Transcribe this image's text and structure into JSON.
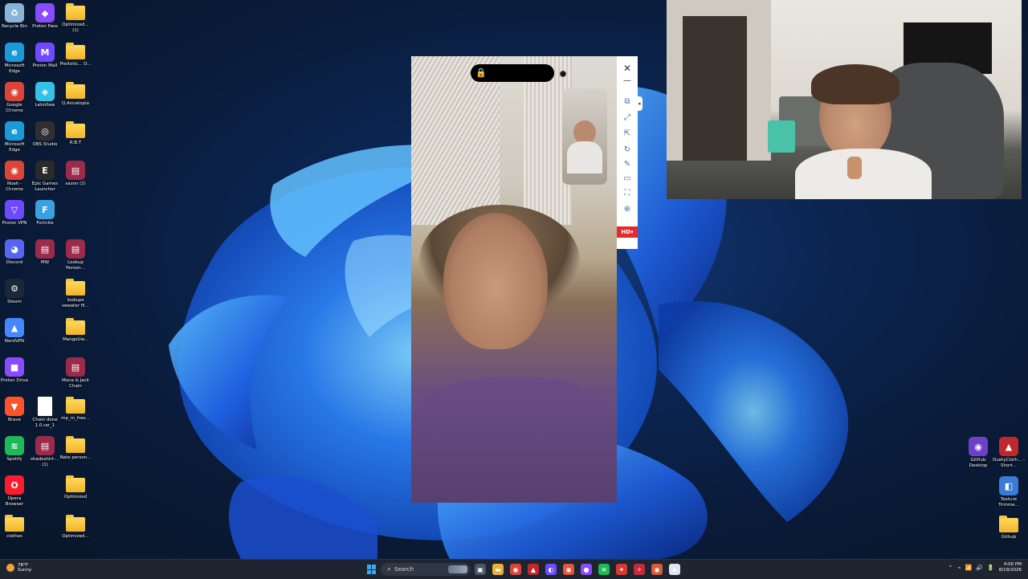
{
  "desktop": {
    "icons_col1": [
      {
        "label": "Recycle Bin",
        "icon": "recycle-bin-icon",
        "color": "#8ab4d6",
        "glyph": "♻"
      },
      {
        "label": "Microsoft Edge",
        "icon": "edge-icon",
        "color": "#1a9ad6",
        "glyph": "e"
      },
      {
        "label": "Google Chrome",
        "icon": "chrome-icon",
        "color": "#db4437",
        "glyph": "◉"
      },
      {
        "label": "Microsoft Edge",
        "icon": "edge-icon",
        "color": "#1a9ad6",
        "glyph": "e"
      },
      {
        "label": "Noah - Chrome",
        "icon": "chrome-icon",
        "color": "#db4437",
        "glyph": "◉"
      },
      {
        "label": "Proton VPN",
        "icon": "proton-vpn-icon",
        "color": "#6d4aff",
        "glyph": "▽"
      },
      {
        "label": "Discord",
        "icon": "discord-icon",
        "color": "#5865f2",
        "glyph": "◕"
      },
      {
        "label": "Steam",
        "icon": "steam-icon",
        "color": "#1b2838",
        "glyph": "⚙"
      },
      {
        "label": "NordVPN",
        "icon": "nordvpn-icon",
        "color": "#4687ff",
        "glyph": "▲"
      },
      {
        "label": "Proton Drive",
        "icon": "proton-drive-icon",
        "color": "#8a4aff",
        "glyph": "■"
      },
      {
        "label": "Brave",
        "icon": "brave-icon",
        "color": "#fb542b",
        "glyph": "▼"
      },
      {
        "label": "Spotify",
        "icon": "spotify-icon",
        "color": "#1db954",
        "glyph": "≋"
      },
      {
        "label": "Opera Browser",
        "icon": "opera-icon",
        "color": "#ff1b2d",
        "glyph": "O"
      },
      {
        "label": "clothes",
        "icon": "folder-icon",
        "color": "#f0b429",
        "glyph": ""
      }
    ],
    "icons_col2": [
      {
        "label": "Proton Pass",
        "icon": "proton-pass-icon",
        "color": "#8a4aff",
        "glyph": "◆"
      },
      {
        "label": "Proton Mail",
        "icon": "proton-mail-icon",
        "color": "#6d4aff",
        "glyph": "M"
      },
      {
        "label": "LetsView",
        "icon": "letsview-icon",
        "color": "#36c0e8",
        "glyph": "◈"
      },
      {
        "label": "OBS Studio",
        "icon": "obs-icon",
        "color": "#302e31",
        "glyph": "◎"
      },
      {
        "label": "Epic Games Launcher",
        "icon": "epic-games-icon",
        "color": "#2a2a2a",
        "glyph": "E"
      },
      {
        "label": "Fortnite",
        "icon": "fortnite-icon",
        "color": "#3aa0e0",
        "glyph": "F"
      },
      {
        "label": "MW",
        "icon": "winrar-icon",
        "color": "#9c2a4a",
        "glyph": "▤"
      },
      {
        "label": "",
        "icon": "",
        "color": "",
        "glyph": ""
      },
      {
        "label": "",
        "icon": "",
        "color": "",
        "glyph": ""
      },
      {
        "label": "",
        "icon": "",
        "color": "",
        "glyph": ""
      },
      {
        "label": "Chain done 1.0.rar_1",
        "icon": "file-icon",
        "color": "#ffffff",
        "glyph": ""
      },
      {
        "label": "shadeshirt-... (1)",
        "icon": "winrar-icon",
        "color": "#9c2a4a",
        "glyph": "▤"
      },
      {
        "label": "",
        "icon": "",
        "color": "",
        "glyph": ""
      },
      {
        "label": "",
        "icon": "",
        "color": "",
        "glyph": ""
      }
    ],
    "icons_col3": [
      {
        "label": "Optimized... (1)",
        "icon": "folder-icon",
        "color": "#f0b429",
        "glyph": ""
      },
      {
        "label": "PreXotic... O...",
        "icon": "folder-icon",
        "color": "#f0b429",
        "glyph": ""
      },
      {
        "label": "Q.Annatopia",
        "icon": "folder-icon",
        "color": "#f0b429",
        "glyph": ""
      },
      {
        "label": "R.B.T",
        "icon": "folder-icon",
        "color": "#f0b429",
        "glyph": ""
      },
      {
        "label": "sazon (2)",
        "icon": "winrar-icon",
        "color": "#9c2a4a",
        "glyph": "▤"
      },
      {
        "label": "",
        "icon": "",
        "color": "",
        "glyph": ""
      },
      {
        "label": "Lookup Person...",
        "icon": "winrar-icon",
        "color": "#9c2a4a",
        "glyph": "▤"
      },
      {
        "label": "lookups sweater fil...",
        "icon": "folder-icon",
        "color": "#f0b429",
        "glyph": ""
      },
      {
        "label": "MangoUw...",
        "icon": "folder-icon",
        "color": "#f0b429",
        "glyph": ""
      },
      {
        "label": "Mona & Jack Chain",
        "icon": "winrar-icon",
        "color": "#9c2a4a",
        "glyph": "▤"
      },
      {
        "label": "mp_m_free...",
        "icon": "folder-icon",
        "color": "#f0b429",
        "glyph": ""
      },
      {
        "label": "Nate person...",
        "icon": "folder-icon",
        "color": "#f0b429",
        "glyph": ""
      },
      {
        "label": "Optimized",
        "icon": "folder-icon",
        "color": "#f0b429",
        "glyph": ""
      },
      {
        "label": "Optimized...",
        "icon": "folder-icon",
        "color": "#f0b429",
        "glyph": ""
      }
    ],
    "icons_right": [
      {
        "label": "GitHub Desktop",
        "icon": "github-desktop-icon",
        "color": "#6e40c9",
        "glyph": "◉"
      },
      {
        "label": "DuetyCloth... - Short...",
        "icon": "shortcut-icon",
        "color": "#c0282d",
        "glyph": "▲"
      },
      {
        "label": "Texture Trimme...",
        "icon": "texture-trimmer-icon",
        "color": "#3a7bd5",
        "glyph": "◧"
      },
      {
        "label": "Github",
        "icon": "folder-icon",
        "color": "#f0b429",
        "glyph": ""
      }
    ]
  },
  "mirror_toolbar": {
    "close": "✕",
    "minimize": "—",
    "tools": [
      "⧉",
      "⤢",
      "⇱",
      "↻",
      "✎",
      "▭",
      "⛶",
      "⊕"
    ],
    "tool_names": [
      "screenshot-tool-icon",
      "fullscreen-icon",
      "pin-icon",
      "rotate-icon",
      "draw-icon",
      "window-icon",
      "crop-icon",
      "more-icon"
    ],
    "hd_label": "HD▾",
    "handle": "◂"
  },
  "phone": {
    "lock": "🔒"
  },
  "taskbar": {
    "weather_temp": "78°F",
    "weather_desc": "Sunny",
    "search_label": "Search",
    "search_icon": "⌕",
    "apps": [
      {
        "name": "task-view-icon",
        "color": "#4a5566",
        "glyph": "▣"
      },
      {
        "name": "file-explorer-icon",
        "color": "#e8b23a",
        "glyph": "▬"
      },
      {
        "name": "chrome-taskbar-icon",
        "color": "#db4437",
        "glyph": "◉"
      },
      {
        "name": "app-red-icon",
        "color": "#c0282d",
        "glyph": "▲"
      },
      {
        "name": "proton-vpn-taskbar-icon",
        "color": "#6d4aff",
        "glyph": "◐"
      },
      {
        "name": "chrome-taskbar-icon-2",
        "color": "#e5533d",
        "glyph": "◉"
      },
      {
        "name": "app-chat-icon",
        "color": "#8a4aff",
        "glyph": "●"
      },
      {
        "name": "spotify-taskbar-icon",
        "color": "#1db954",
        "glyph": "≋"
      },
      {
        "name": "app-red2-icon",
        "color": "#d63a2f",
        "glyph": "✦"
      },
      {
        "name": "app-red3-icon",
        "color": "#c42a3a",
        "glyph": "✧"
      },
      {
        "name": "app-chrome3-icon",
        "color": "#d65a3a",
        "glyph": "◉"
      },
      {
        "name": "letsview-taskbar-icon",
        "color": "#dfe6ee",
        "glyph": "◈"
      }
    ],
    "tray_chevron": "⌃",
    "tray_icons": [
      "⌁",
      "📶",
      "🔊",
      "🔋"
    ],
    "time": "4:00 PM",
    "date": "8/19/2026"
  }
}
